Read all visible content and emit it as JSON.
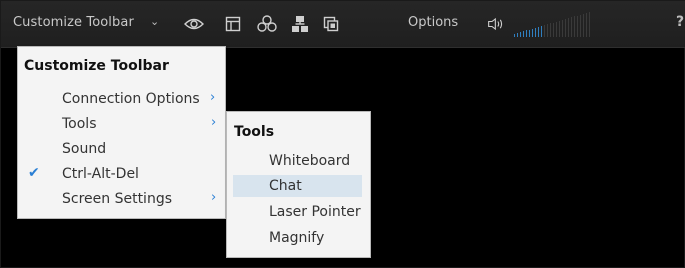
{
  "toolbar": {
    "title": "Customize Toolbar",
    "options_label": "Options",
    "help_label": "?",
    "volume_level": 0.35
  },
  "icons": {
    "dropdown": "chevron-down-icon",
    "view": "eye-icon",
    "window": "window-icon",
    "share": "share-circles-icon",
    "network": "network-icon",
    "clipboard": "clipboard-icon",
    "speaker": "speaker-icon"
  },
  "main_menu": {
    "header": "Customize Toolbar",
    "items": [
      {
        "label": "Connection Options",
        "has_submenu": true,
        "checked": false
      },
      {
        "label": "Tools",
        "has_submenu": true,
        "checked": false
      },
      {
        "label": "Sound",
        "has_submenu": false,
        "checked": false
      },
      {
        "label": "Ctrl-Alt-Del",
        "has_submenu": false,
        "checked": true
      },
      {
        "label": "Screen Settings",
        "has_submenu": true,
        "checked": false
      }
    ]
  },
  "submenu": {
    "header": "Tools",
    "items": [
      {
        "label": "Whiteboard",
        "highlighted": false
      },
      {
        "label": "Chat",
        "highlighted": true
      },
      {
        "label": "Laser Pointer",
        "highlighted": false
      },
      {
        "label": "Magnify",
        "highlighted": false
      }
    ]
  },
  "colors": {
    "accent": "#2a7fd4",
    "highlight": "#d8e4ee",
    "toolbar_bg": "#222222"
  }
}
